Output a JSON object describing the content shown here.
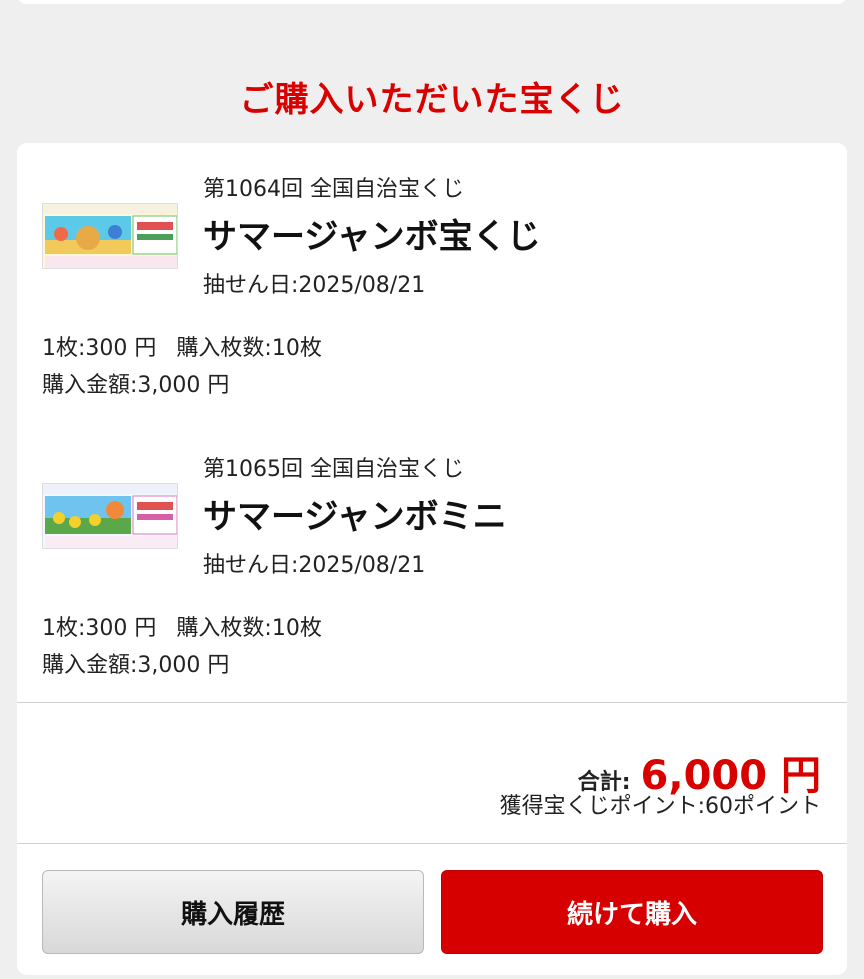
{
  "section_title": "ご購入いただいた宝くじ",
  "tickets": [
    {
      "round": "第1064回 全国自治宝くじ",
      "name": "サマージャンボ宝くじ",
      "draw_date": "抽せん日:2025/08/21",
      "unit_price": "1枚:300 円",
      "quantity": "購入枚数:10枚",
      "amount": "購入金額:3,000 円"
    },
    {
      "round": "第1065回 全国自治宝くじ",
      "name": "サマージャンボミニ",
      "draw_date": "抽せん日:2025/08/21",
      "unit_price": "1枚:300 円",
      "quantity": "購入枚数:10枚",
      "amount": "購入金額:3,000 円"
    }
  ],
  "summary": {
    "total_label": "合計:",
    "total_value": "6,000 円",
    "points": "獲得宝くじポイント:60ポイント"
  },
  "buttons": {
    "history": "購入履歴",
    "continue": "続けて購入"
  },
  "colors": {
    "accent": "#d90000",
    "background": "#efefef"
  }
}
